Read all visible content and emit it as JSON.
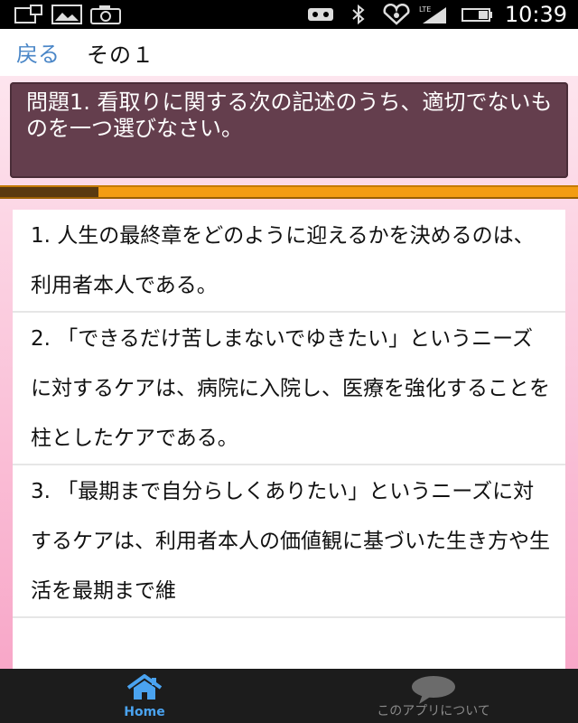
{
  "status_bar": {
    "time": "10:39",
    "icons": [
      "screenshot-icon",
      "image-icon",
      "camera-icon",
      "voicemail-icon",
      "bluetooth-icon",
      "heart-wifi-icon",
      "lte-signal-icon",
      "battery-icon"
    ]
  },
  "nav": {
    "back_label": "戻る",
    "title": "その１"
  },
  "question": {
    "text": "問題1. 看取りに関する次の記述のうち、適切でないものを一つ選びなさい。"
  },
  "progress": {
    "value_fraction": 0.17
  },
  "choices": [
    "1. 人生の最終章をどのように迎えるかを決めるのは、利用者本人である。",
    "2. 「できるだけ苦しまないでゆきたい」というニーズに対するケアは、病院に入院し、医療を強化することを柱としたケアである。",
    "3. 「最期まで自分らしくありたい」というニーズに対するケアは、利用者本人の価値観に基づいた生き方や生活を最期まで維"
  ],
  "tabs": {
    "home_label": "Home",
    "about_label": "このアプリについて"
  },
  "colors": {
    "question_bg": "#643e4d",
    "progress_bar": "#f39c12",
    "accent_blue": "#4a86c7",
    "tab_active": "#4aa3f0"
  }
}
